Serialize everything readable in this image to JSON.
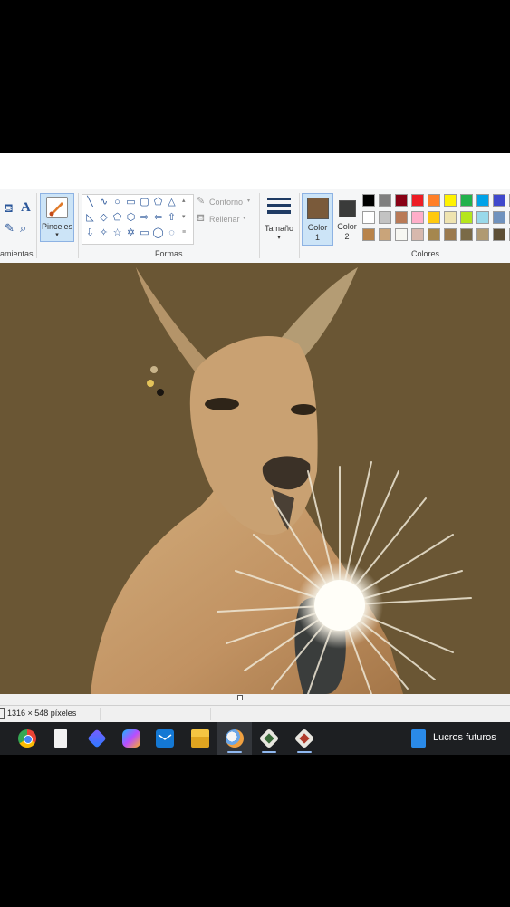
{
  "ribbon": {
    "herramientas_label": "amientas",
    "brushes_label": "Pinceles",
    "shapes_label": "Formas",
    "outline_label": "Contorno",
    "fill_label": "Rellenar",
    "size_label": "Tamaño",
    "color1_label_line1": "Color",
    "color1_label_line2": "1",
    "color2_label_line1": "Color",
    "color2_label_line2": "2",
    "colors_label": "Colores",
    "color1_value": "#7a5a3a",
    "color2_value": "#3a3b3a",
    "palette_row1": [
      "#000000",
      "#7f7f7f",
      "#880015",
      "#ed1c24",
      "#ff7f27",
      "#fff200",
      "#22b14c",
      "#00a2e8",
      "#3f48cc",
      "#a349a4"
    ],
    "palette_row2": [
      "#ffffff",
      "#c3c3c3",
      "#b97a57",
      "#ffaec9",
      "#ffc90e",
      "#efe4b0",
      "#b5e61d",
      "#99d9ea",
      "#7092be",
      "#c8bfe7"
    ],
    "palette_row3": [
      "#b8834a",
      "#c9a47a",
      "#f7f7f2",
      "#d7b8ad",
      "#a5874e",
      "#9b7a4e",
      "#7a6a47",
      "#b09a72",
      "#5e4f35",
      "#c8a36b"
    ]
  },
  "status": {
    "dimensions": "1316 × 548 píxeles"
  },
  "taskbar": {
    "apps": [
      "chrome-icon",
      "file-icon",
      "copilot-dev-icon",
      "copilot-icon",
      "mail-icon",
      "file-explorer-icon",
      "paint-icon",
      "photo-viewer-icon",
      "photo-editor-icon"
    ],
    "weather_label": "Lucros futuros"
  }
}
